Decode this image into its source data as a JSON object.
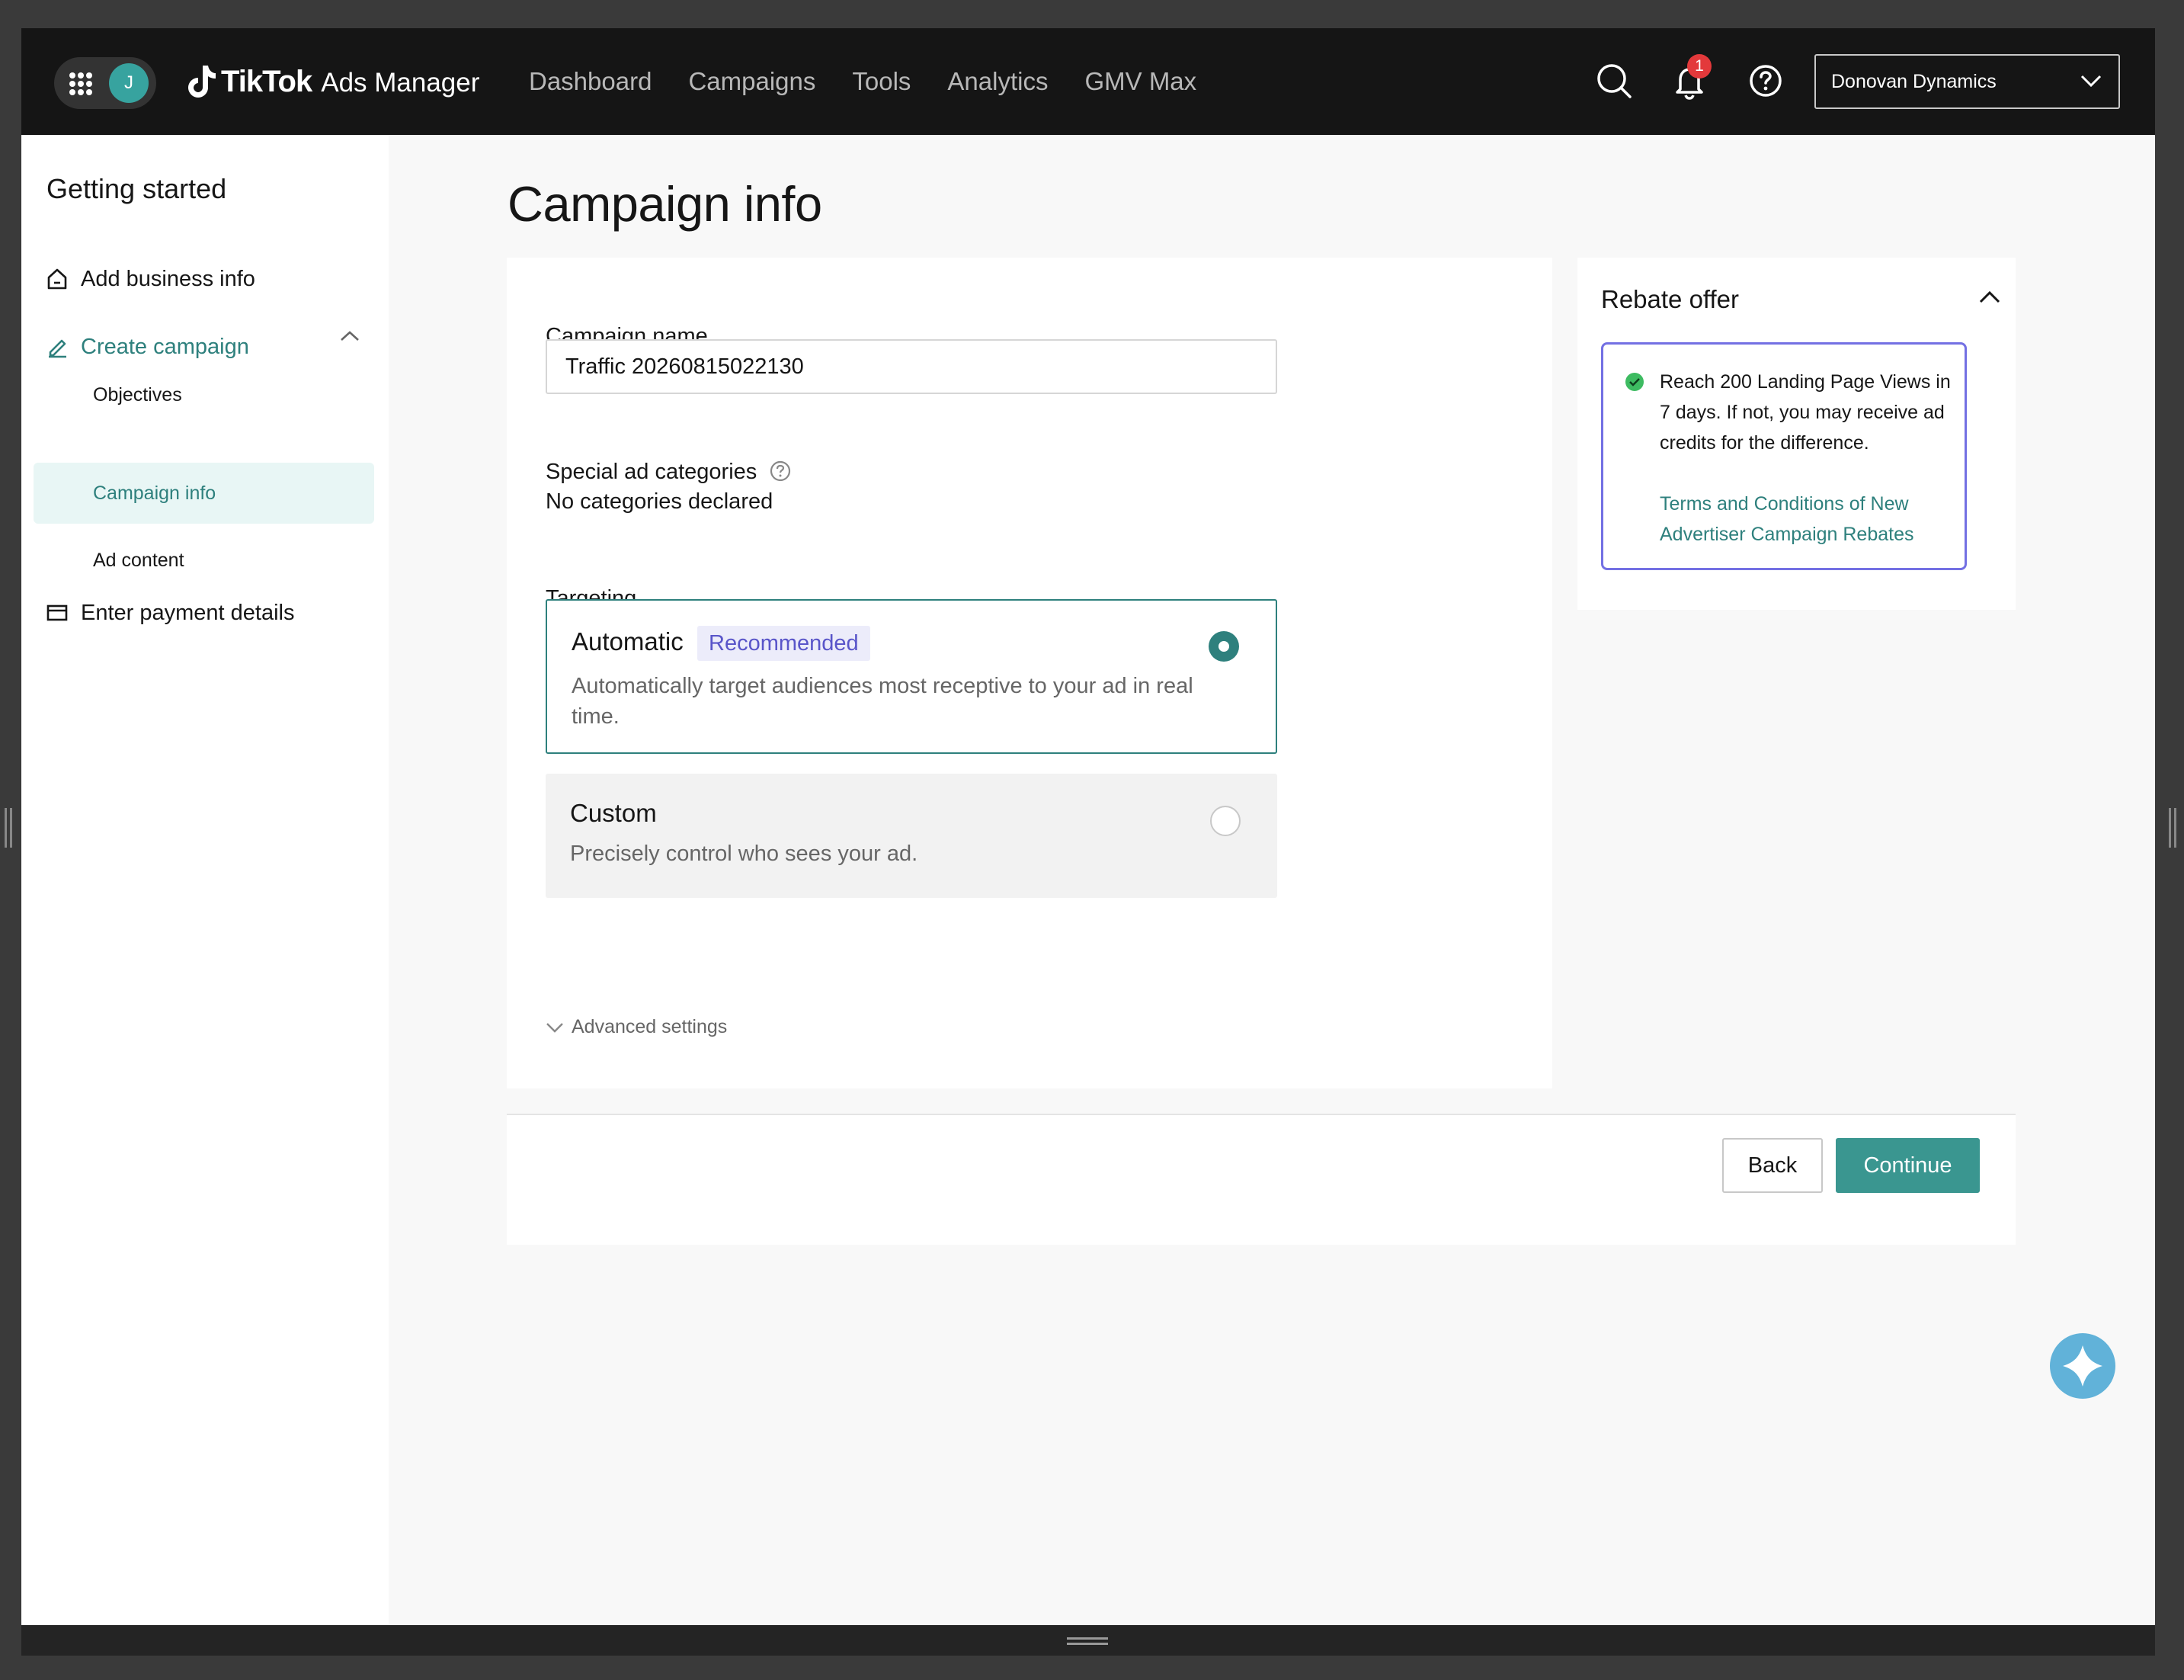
{
  "topbar": {
    "avatar_initial": "J",
    "brand": "TikTok",
    "product": "Ads Manager",
    "nav": [
      "Dashboard",
      "Campaigns",
      "Tools",
      "Analytics",
      "GMV Max"
    ],
    "notification_count": "1",
    "account_name": "Donovan Dynamics",
    "icons": [
      "apps-grid-icon",
      "search-icon",
      "bell-icon",
      "help-icon",
      "chevron-down-icon"
    ]
  },
  "sidebar": {
    "title": "Getting started",
    "add_business": "Add business info",
    "create_campaign": "Create campaign",
    "steps": [
      "Objectives",
      "Campaign info",
      "Ad content"
    ],
    "payment": "Enter payment details"
  },
  "main": {
    "page_title": "Campaign info",
    "campaign_name_label": "Campaign name",
    "campaign_name_value": "Traffic 20260815022130",
    "special_label": "Special ad categories",
    "special_value": "No categories declared",
    "targeting_label": "Targeting",
    "automatic_title": "Automatic",
    "recommended_tag": "Recommended",
    "automatic_desc": "Automatically target audiences most receptive to your ad in real time.",
    "custom_title": "Custom",
    "custom_desc": "Precisely control who sees your ad.",
    "advanced_settings": "Advanced settings",
    "selected_targeting": "Automatic"
  },
  "rebate": {
    "title": "Rebate offer",
    "text": "Reach 200 Landing Page Views in 7 days. If not, you may receive ad credits for the difference.",
    "link": "Terms and Conditions of New Advertiser Campaign Rebates"
  },
  "footer": {
    "back": "Back",
    "continue": "Continue"
  },
  "colors": {
    "accent": "#2e807d",
    "topbar": "#151515",
    "rebate_border": "#7370e3",
    "tag_text": "#5955c9"
  }
}
